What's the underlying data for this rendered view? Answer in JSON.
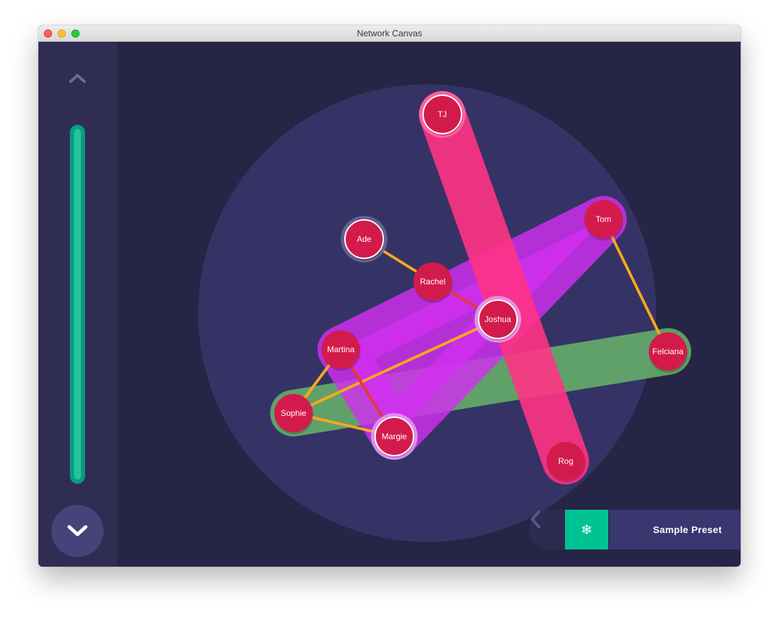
{
  "window": {
    "title": "Network Canvas"
  },
  "sidebar": {
    "up_icon": "chevron-up-icon",
    "down_icon": "chevron-down-icon",
    "progress": 1.0,
    "accent_color": "#23c49a"
  },
  "network": {
    "nodes": [
      {
        "id": "tj",
        "label": "TJ"
      },
      {
        "id": "tom",
        "label": "Tom"
      },
      {
        "id": "ade",
        "label": "Ade"
      },
      {
        "id": "rachel",
        "label": "Rachel"
      },
      {
        "id": "joshua",
        "label": "Joshua"
      },
      {
        "id": "martina",
        "label": "Martina"
      },
      {
        "id": "felciana",
        "label": "Felciana"
      },
      {
        "id": "sophie",
        "label": "Sophie"
      },
      {
        "id": "margie",
        "label": "Margie"
      },
      {
        "id": "rog",
        "label": "Rog"
      }
    ],
    "edges": [
      {
        "from": "ade",
        "to": "rachel",
        "color": "#f7a81b"
      },
      {
        "from": "rachel",
        "to": "joshua",
        "color": "#e53935"
      },
      {
        "from": "joshua",
        "to": "sophie",
        "color": "#f7a81b"
      },
      {
        "from": "martina",
        "to": "sophie",
        "color": "#f7a81b"
      },
      {
        "from": "martina",
        "to": "margie",
        "color": "#e53935"
      },
      {
        "from": "sophie",
        "to": "margie",
        "color": "#f7a81b"
      },
      {
        "from": "tom",
        "to": "felciana",
        "color": "#f7a81b"
      }
    ],
    "groups": [
      {
        "id": "pink",
        "color": "#ff3385",
        "members": [
          "tj",
          "rog"
        ]
      },
      {
        "id": "purple",
        "color": "#d22ef0",
        "members": [
          "tom",
          "martina",
          "margie"
        ]
      },
      {
        "id": "green",
        "color": "#6ab96a",
        "members": [
          "sophie",
          "felciana"
        ]
      }
    ],
    "node_color": "#d31b4b"
  },
  "preset": {
    "icon": "snowflake-icon",
    "icon_glyph": "❄",
    "name": "Sample Preset",
    "prev_icon": "chevron-left-icon",
    "next_icon": "chevron-right-icon"
  }
}
